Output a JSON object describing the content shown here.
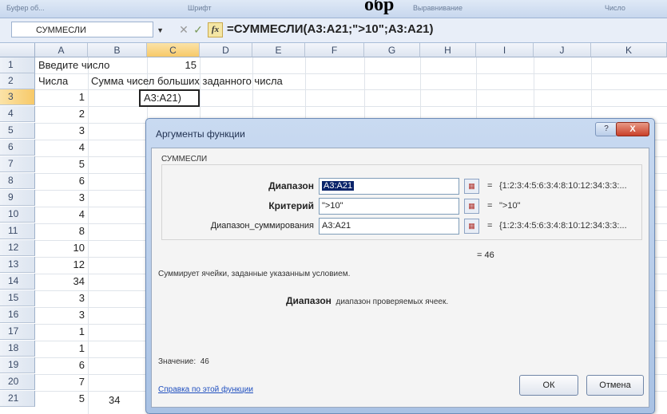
{
  "caption": "обр",
  "ribbon": {
    "groups": [
      "Буфер об...",
      "Шрифт",
      "Выравнивание",
      "Число"
    ]
  },
  "formula_bar": {
    "name_box": "СУММЕСЛИ",
    "cancel_symbol": "✕",
    "enter_symbol": "✓",
    "fx_label": "fx",
    "formula": "=СУММЕСЛИ(A3:A21;\">10\";A3:A21)"
  },
  "sheet": {
    "columns": [
      "A",
      "B",
      "C",
      "D",
      "E",
      "F",
      "G",
      "H",
      "I",
      "J",
      "K"
    ],
    "rows": [
      "1",
      "2",
      "3",
      "4",
      "5",
      "6",
      "7",
      "8",
      "9",
      "10",
      "11",
      "12",
      "13",
      "14",
      "15",
      "16",
      "17",
      "18",
      "19",
      "20",
      "21"
    ],
    "selected_column": "C",
    "selected_row": "3",
    "cells": {
      "a1": "Введите число",
      "c1": "15",
      "a2": "Числа",
      "b2": "Сумма чисел больших заданного числа",
      "c3_edit": "A3:A21)",
      "a_values": [
        "1",
        "2",
        "3",
        "4",
        "5",
        "6",
        "3",
        "4",
        "8",
        "10",
        "12",
        "34",
        "3",
        "3",
        "1",
        "1",
        "6",
        "7",
        "5"
      ],
      "b21": "34"
    }
  },
  "dialog": {
    "title": "Аргументы функции",
    "help_symbol": "?",
    "close_symbol": "X",
    "function_name": "СУММЕСЛИ",
    "arguments": [
      {
        "label": "Диапазон",
        "value": "A3:A21",
        "result": "{1:2:3:4:5:6:3:4:8:10:12:34:3:3:..."
      },
      {
        "label": "Критерий",
        "value": "\">10\"",
        "result": "\">10\""
      },
      {
        "label": "Диапазон_суммирования",
        "value": "A3:A21",
        "result": "{1:2:3:4:5:6:3:4:8:10:12:34:3:3:..."
      }
    ],
    "equals": "=",
    "formula_result": "= 46",
    "description": "Суммирует ячейки, заданные указанным условием.",
    "arg_desc_name": "Диапазон",
    "arg_desc_text": "диапазон проверяемых ячеек.",
    "value_label": "Значение:",
    "value": "46",
    "help_link": "Справка по этой функции",
    "ok_label": "ОК",
    "cancel_label": "Отмена"
  }
}
